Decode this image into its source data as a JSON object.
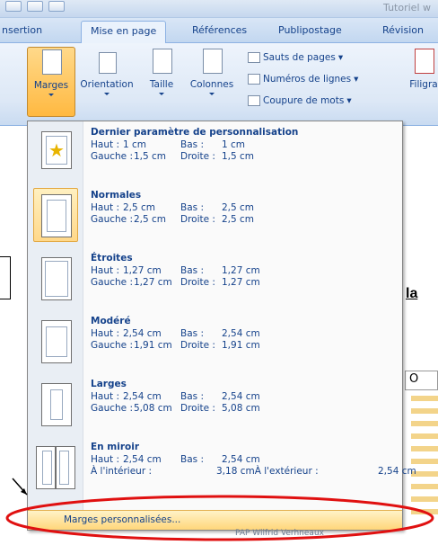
{
  "window": {
    "title_partial": "Tutoriel w"
  },
  "tabs": [
    {
      "label": "nsertion"
    },
    {
      "label": "Mise en page"
    },
    {
      "label": "Références"
    },
    {
      "label": "Publipostage"
    },
    {
      "label": "Révision"
    }
  ],
  "ribbon": {
    "marges": "Marges",
    "orientation": "Orientation",
    "taille": "Taille",
    "colonnes": "Colonnes",
    "sauts": "Sauts de pages",
    "numeros": "Numéros de lignes",
    "coupure": "Coupure de mots",
    "filigrane_partial": "Filigra"
  },
  "menu": {
    "items": [
      {
        "title": "Dernier paramètre de personnalisation",
        "l1": [
          "Haut :",
          "1 cm",
          "Bas :",
          "1 cm"
        ],
        "l2": [
          "Gauche :",
          "1,5 cm",
          "Droite :",
          "1,5 cm"
        ]
      },
      {
        "title": "Normales",
        "l1": [
          "Haut :",
          "2,5 cm",
          "Bas :",
          "2,5 cm"
        ],
        "l2": [
          "Gauche :",
          "2,5 cm",
          "Droite :",
          "2,5 cm"
        ]
      },
      {
        "title": "Étroites",
        "l1": [
          "Haut :",
          "1,27 cm",
          "Bas :",
          "1,27 cm"
        ],
        "l2": [
          "Gauche :",
          "1,27 cm",
          "Droite :",
          "1,27 cm"
        ]
      },
      {
        "title": "Modéré",
        "l1": [
          "Haut :",
          "2,54 cm",
          "Bas :",
          "2,54 cm"
        ],
        "l2": [
          "Gauche :",
          "1,91 cm",
          "Droite :",
          "1,91 cm"
        ]
      },
      {
        "title": "Larges",
        "l1": [
          "Haut :",
          "2,54 cm",
          "Bas :",
          "2,54 cm"
        ],
        "l2": [
          "Gauche :",
          "5,08 cm",
          "Droite :",
          "5,08 cm"
        ]
      },
      {
        "title": "En miroir",
        "l1": [
          "Haut :",
          "2,54 cm",
          "Bas :",
          "2,54 cm"
        ],
        "l2_full": "À l'intérieur :",
        "l2_mid": "3,18 cmÀ l'extérieur :",
        "l2_end": "2,54 cm"
      }
    ],
    "custom": "Marges personnalisées..."
  },
  "document": {
    "heading_partial": "la",
    "box_partial": "O",
    "footer_partial": "PAP Wilfrid Verhneaux"
  },
  "colors": {
    "selected": "#ffd88a",
    "accent": "#15428b",
    "annotation": "#e01010"
  }
}
